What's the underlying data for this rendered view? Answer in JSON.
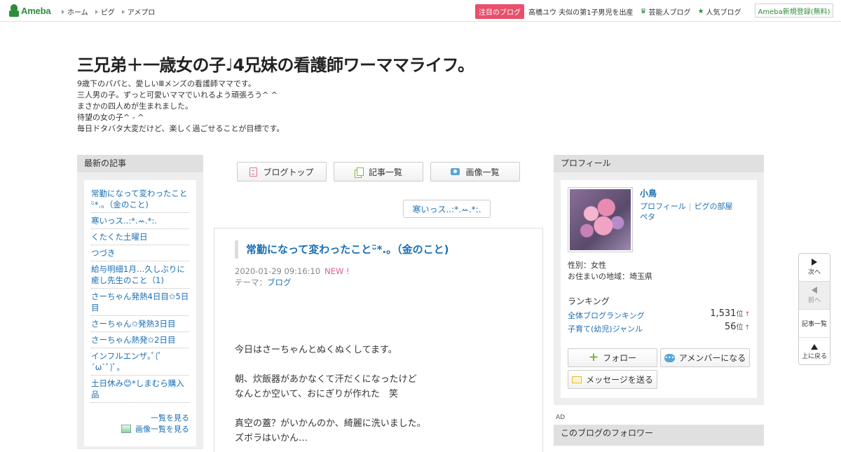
{
  "topbar": {
    "logo": "Ameba",
    "nav": [
      "ホーム",
      "ピグ",
      "アメプロ"
    ],
    "pickup_badge": "注目のブログ",
    "pickup_text": "高橋ユウ 夫似の第1子男児を出産",
    "celebrity_blog": "芸能人ブログ",
    "popular_blog": "人気ブログ",
    "signup": "Ameba新規登録(無料)"
  },
  "header": {
    "title": "三兄弟＋一歳女の子♩4兄妹の看護師ワーママライフ。",
    "description": [
      "9歳下のパパと、愛しいⅢメンズの看護師ママです。",
      "三人男の子。ずっと可愛いママでいれるよう頑張ろう^ ^",
      "まさかの四人めが生まれました。",
      "待望の女の子^ - ^",
      "毎日ドタバタ大変だけど、楽しく過ごせることが目標です。"
    ]
  },
  "left": {
    "heading": "最新の記事",
    "entries": [
      "常勤になって変わったことᵕ̈*.。（金のこと)",
      "寒いっス..:*.ꕀ.*:.",
      "くたくた土曜日",
      "つづき",
      "給与明細1月…久しぶりに癒し先生のこと（1)",
      "さーちゃん発熱4日目✩5日目",
      "さーちゃん✩発熱3日目",
      "さーちゃん熱発✩2日目",
      "インフルエンザ｡ﾟ(ﾟ´ω`ﾟ)ﾟ｡",
      "土日休み😊*しまむら購入品"
    ],
    "more_link": "一覧を見る",
    "image_list_link": "画像一覧を見る"
  },
  "center": {
    "buttons": {
      "blog_top": "ブログトップ",
      "entry_list": "記事一覧",
      "image_list": "画像一覧"
    },
    "prev_entry": "寒いっス..:*.ꕀ.*:.",
    "article": {
      "title": "常勤になって変わったことᵕ̈*.。（金のこと)",
      "date": "2020-01-29 09:16:10",
      "new_badge": "NEW !",
      "theme_label": "テーマ：",
      "theme": "ブログ",
      "body": [
        "今日はさーちゃんとぬくぬくしてます。",
        "",
        "朝、炊飯器があかなくて汗だくになったけど",
        "なんとか空いて、おにぎりが作れた　笑",
        "",
        "真空の蓋？がいかんのか、綺麗に洗いました。",
        "ズボラはいかん…"
      ]
    }
  },
  "right": {
    "heading": "プロフィール",
    "name": "小鳥",
    "profile_link": "プロフィール",
    "pig_room_link": "ピグの部屋",
    "peta_link": "ペタ",
    "gender": "性別：女性",
    "area": "お住まいの地域：埼玉県",
    "ranking_title": "ランキング",
    "rankings": [
      {
        "label": "全体ブログランキング",
        "value": "1,531",
        "unit": "位",
        "arrow": "↑"
      },
      {
        "label": "子育て(幼児)ジャンル",
        "value": "56",
        "unit": "位",
        "arrow": "↑"
      }
    ],
    "follow": "フォロー",
    "amember": "アメンバーになる",
    "message": "メッセージを送る",
    "ad_label": "AD",
    "followers_heading": "このブログのフォロワー"
  },
  "sidenav": {
    "next": "次へ",
    "prev": "前へ",
    "list": "記事一覧",
    "top": "上に戻る"
  },
  "colors": {
    "link": "#1a6fb5",
    "brand_green": "#2d8c3c",
    "pickup_badge": "#e8506c",
    "new_badge": "#e05a9a"
  }
}
